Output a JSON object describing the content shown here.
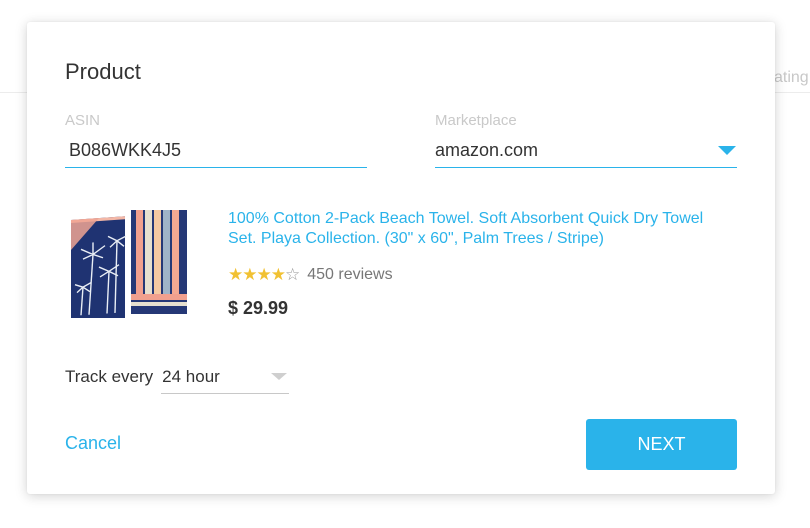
{
  "background": {
    "rating_fragment": "ating"
  },
  "modal": {
    "title": "Product",
    "asin": {
      "label": "ASIN",
      "value": "B086WKK4J5"
    },
    "marketplace": {
      "label": "Marketplace",
      "value": "amazon.com"
    },
    "product": {
      "title": "100% Cotton 2-Pack Beach Towel. Soft Absorbent Quick Dry Towel Set. Playa Collection. (30\" x 60\", Palm Trees / Stripe)",
      "rating": 4,
      "rating_max": 5,
      "stars_filled": "★★★★",
      "stars_empty": "☆",
      "reviews": "450 reviews",
      "price": "$ 29.99"
    },
    "track": {
      "label": "Track every",
      "value": "24 hour"
    },
    "actions": {
      "cancel": "Cancel",
      "next": "NEXT"
    }
  },
  "colors": {
    "accent": "#2ab3ea",
    "star": "#f1c132"
  },
  "icons": {
    "marketplace_dropdown": "caret-down-icon",
    "track_dropdown": "caret-down-icon"
  }
}
